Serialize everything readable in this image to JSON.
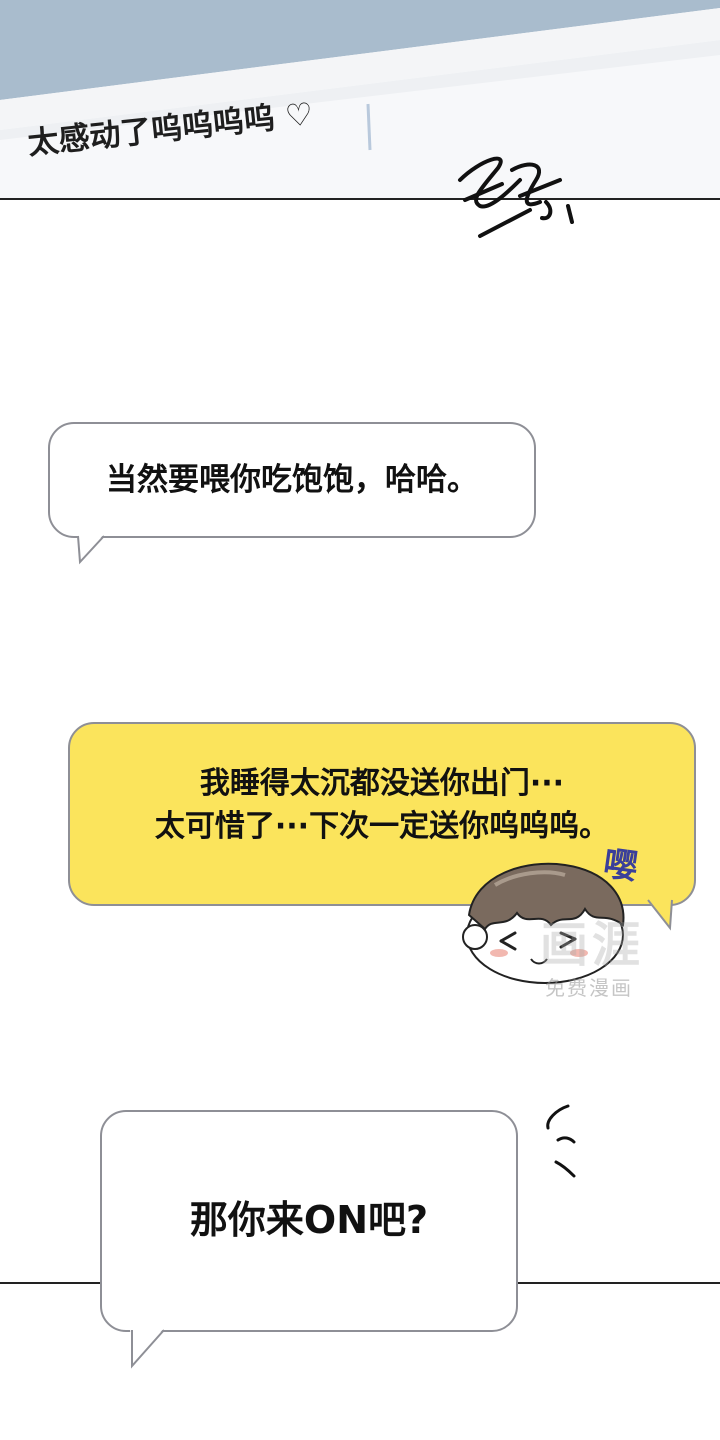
{
  "top_panel": {
    "caption": "太感动了呜呜呜呜 ♡"
  },
  "bubbles": {
    "first": "当然要喂你吃饱饱，哈哈。",
    "second_line1": "我睡得太沉都没送你出门···",
    "second_line2": "太可惜了···下次一定送你呜呜呜。",
    "third": "那你来ON吧?"
  },
  "sfx": {
    "whimper": "嘤"
  },
  "watermark": {
    "logo": "画涯",
    "text": "免费漫画"
  },
  "colors": {
    "yellow_bubble": "#fbe45c",
    "bubble_border": "#8e8f96",
    "top_band": "#a9bccd",
    "sfx_blue": "#3a3f9a"
  }
}
